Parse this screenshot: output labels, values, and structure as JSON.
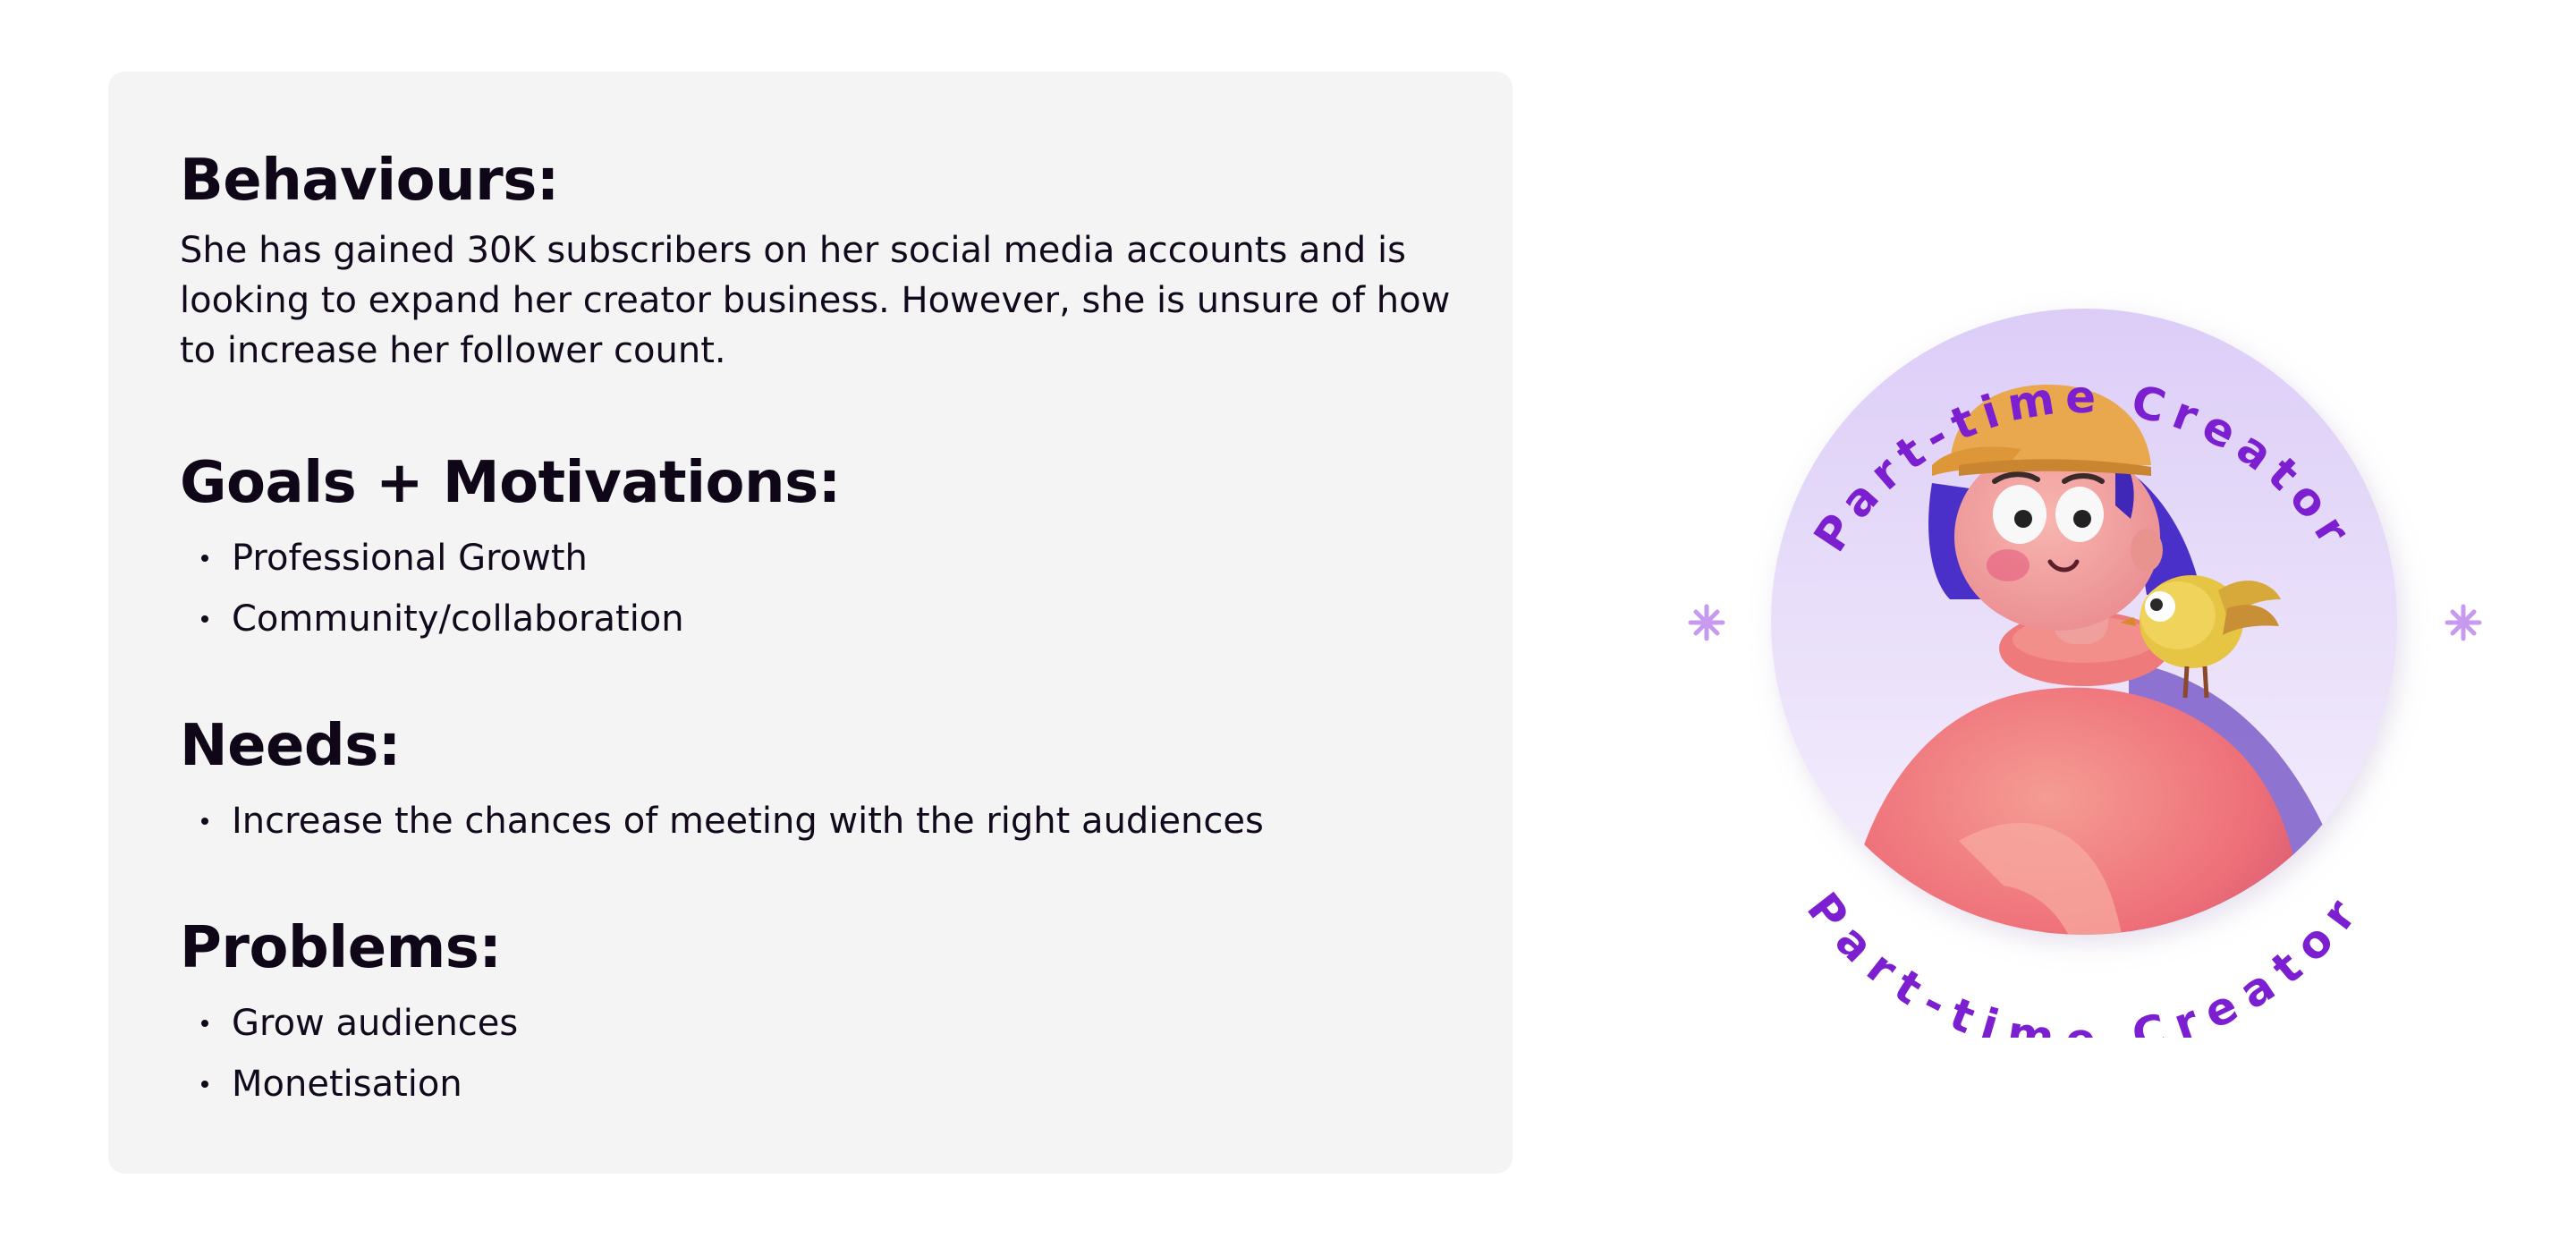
{
  "persona": {
    "behaviours": {
      "heading": "Behaviours:",
      "text": "She has gained 30K subscribers on her social media accounts and is looking to expand her creator business. However, she is unsure of how to increase her follower count."
    },
    "goals": {
      "heading": "Goals + Motivations:",
      "items": [
        "Professional Growth",
        "Community/collaboration"
      ]
    },
    "needs": {
      "heading": "Needs:",
      "items": [
        "Increase the chances of meeting with the right audiences"
      ]
    },
    "problems": {
      "heading": "Problems:",
      "items": [
        "Grow audiences",
        "Monetisation"
      ]
    }
  },
  "badge": {
    "label_top": "Part-time Creator",
    "label_bottom": "Part-time Creator",
    "accent": "#7b1fd0",
    "sparkle": "#c79af0",
    "circle_top": "#dccdf7",
    "circle_bottom": "#f4effc"
  }
}
